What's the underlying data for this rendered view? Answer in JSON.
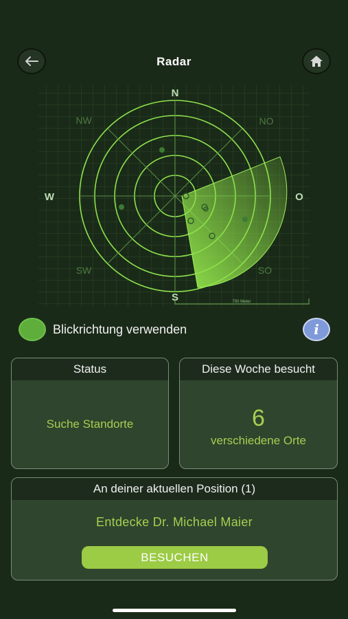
{
  "header": {
    "title": "Radar",
    "back_icon": "arrow-left-icon",
    "home_icon": "home-icon"
  },
  "radar": {
    "directions": {
      "n": "N",
      "no": "NO",
      "o": "O",
      "so": "SO",
      "s": "S",
      "sw": "SW",
      "w": "W",
      "nw": "NW"
    },
    "scale_label": "700 Meter",
    "rings": 5,
    "sweep_color": "#8fe04a",
    "grid_color": "#3f6e34"
  },
  "toggle": {
    "label": "Blickrichtung verwenden",
    "enabled": true,
    "info_icon": "info-icon",
    "info_glyph": "i"
  },
  "status_card": {
    "title": "Status",
    "value": "Suche Standorte"
  },
  "visits_card": {
    "title": "Diese Woche besucht",
    "count": "6",
    "unit": "verschiedene Orte"
  },
  "position_card": {
    "title": "An deiner aktuellen Position (1)",
    "place_text": "Entdecke Dr. Michael Maier",
    "button_label": "BESUCHEN"
  },
  "colors": {
    "background": "#1a2a18",
    "accent_green": "#a6cf52",
    "button_green": "#9ccb45",
    "info_blue": "#7f9ad9"
  }
}
